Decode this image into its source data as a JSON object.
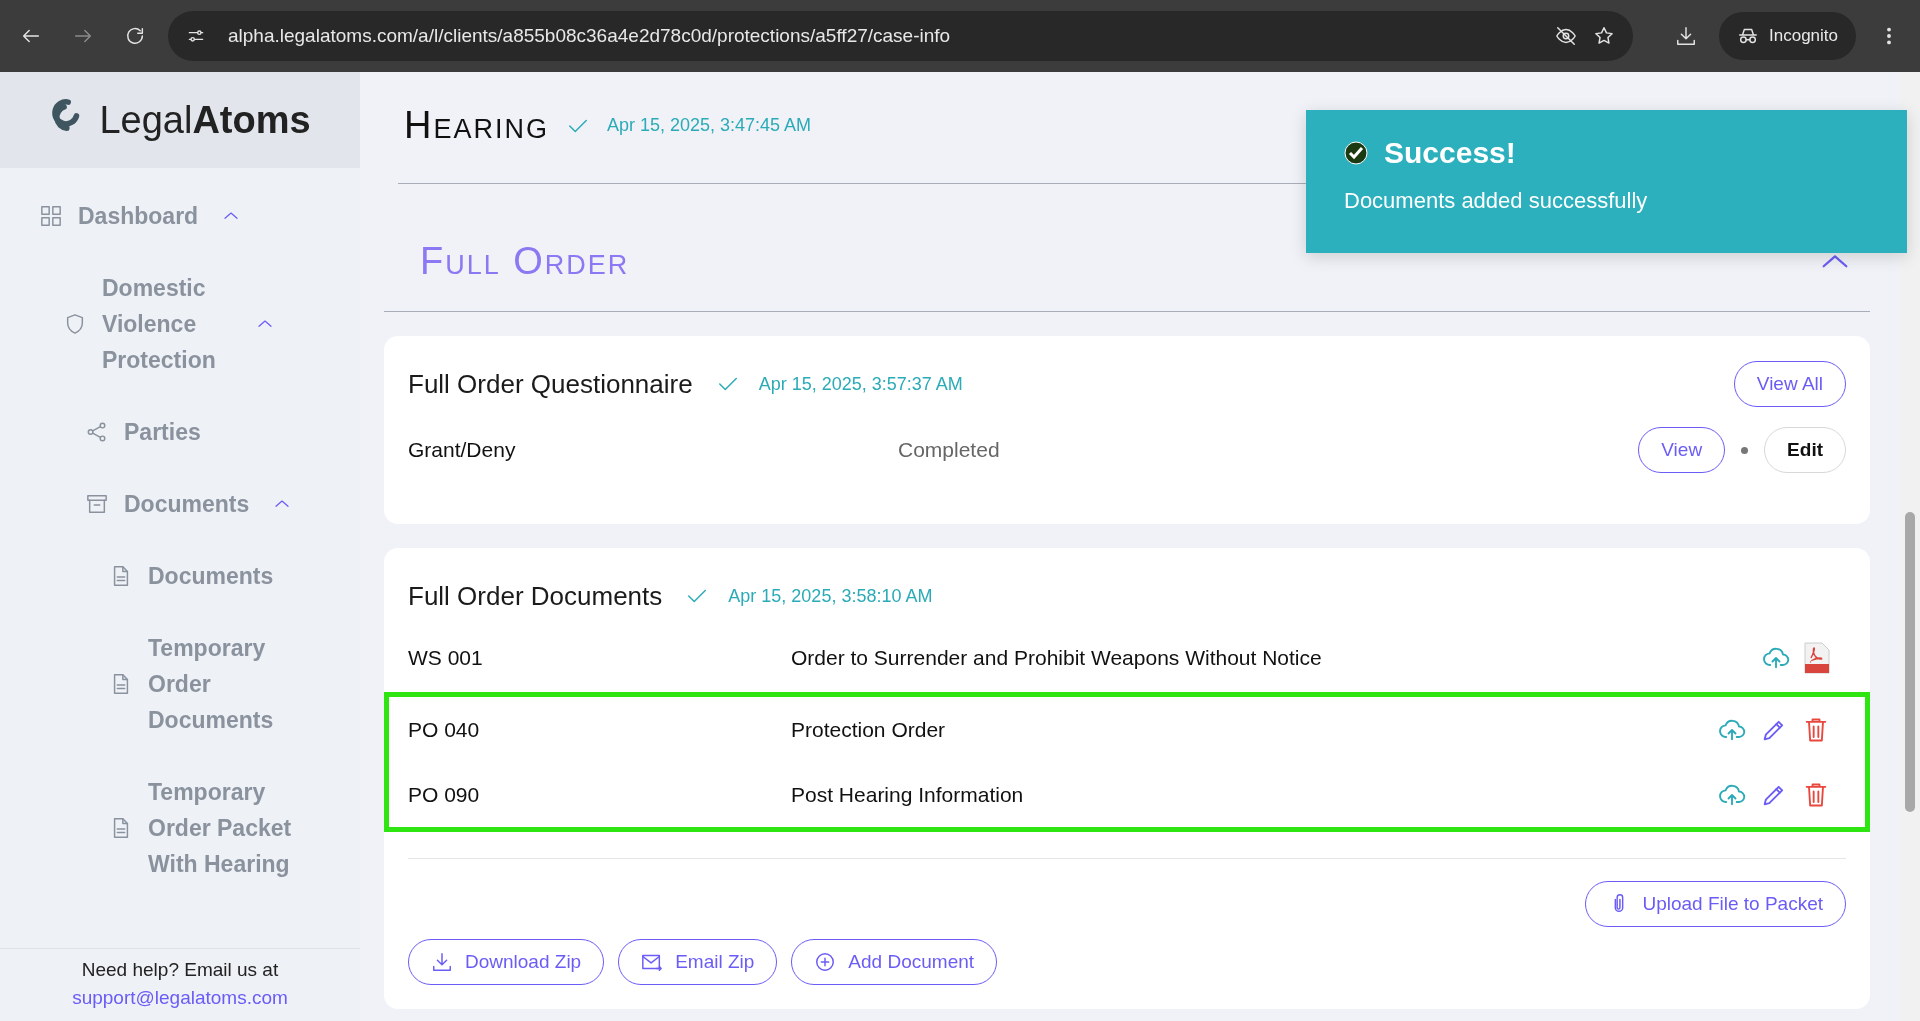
{
  "browser": {
    "url": "alpha.legalatoms.com/a/l/clients/a855b08c36a4e2d78c0d/protections/a5ff27/case-info",
    "profile": "Incognito"
  },
  "sidebar": {
    "logo": {
      "light": "Legal",
      "bold": "Atoms"
    },
    "items": [
      {
        "label": "Dashboard",
        "kind": "grid",
        "expanded": true,
        "children": [
          {
            "label": "Domestic Violence Protection",
            "kind": "shield",
            "expanded": true,
            "children": [
              {
                "label": "Parties",
                "kind": "share"
              },
              {
                "label": "Documents",
                "kind": "archive",
                "expanded": true,
                "children": [
                  {
                    "label": "Documents",
                    "kind": "file"
                  },
                  {
                    "label": "Temporary Order Documents",
                    "kind": "file"
                  },
                  {
                    "label": "Temporary Order Packet With Hearing",
                    "kind": "file"
                  }
                ]
              }
            ]
          }
        ]
      }
    ],
    "help": {
      "text": "Need help? Email us at",
      "link": "support@legalatoms.com"
    }
  },
  "hearing": {
    "title": "Hearing",
    "timestamp": "Apr 15, 2025, 3:47:45 AM"
  },
  "section": {
    "title": "Full Order",
    "expanded": true
  },
  "questionnaire": {
    "title": "Full Order Questionnaire",
    "timestamp": "Apr 15, 2025, 3:57:37 AM",
    "view_all": "View All",
    "rows": [
      {
        "name": "Grant/Deny",
        "status": "Completed",
        "view": "View",
        "edit": "Edit"
      }
    ]
  },
  "documents": {
    "title": "Full Order Documents",
    "timestamp": "Apr 15, 2025, 3:58:10 AM",
    "rows": [
      {
        "code": "WS 001",
        "name": "Order to Surrender and Prohibit Weapons Without Notice",
        "kind": "pdf",
        "highlighted": false
      },
      {
        "code": "PO 040",
        "name": "Protection Order",
        "kind": "editable",
        "highlighted": true
      },
      {
        "code": "PO 090",
        "name": "Post Hearing Information",
        "kind": "editable",
        "highlighted": true
      }
    ],
    "upload": "Upload File to Packet",
    "actions": [
      {
        "label": "Download Zip",
        "kind": "download"
      },
      {
        "label": "Email Zip",
        "kind": "mail"
      },
      {
        "label": "Add Document",
        "kind": "plus"
      }
    ]
  },
  "toast": {
    "title": "Success!",
    "message": "Documents added successfully"
  }
}
